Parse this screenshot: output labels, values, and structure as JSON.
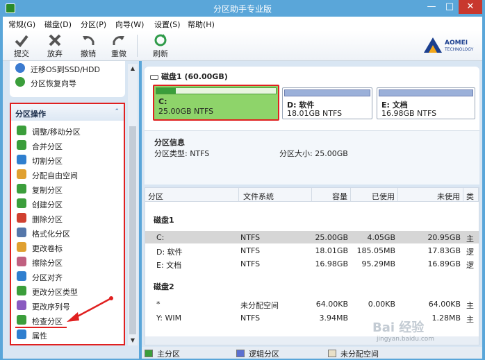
{
  "window": {
    "title": "分区助手专业版"
  },
  "menu": [
    "常规(G)",
    "磁盘(D)",
    "分区(P)",
    "向导(W)",
    "设置(S)",
    "帮助(H)"
  ],
  "toolbar": [
    {
      "label": "提交",
      "icon": "check-icon"
    },
    {
      "label": "放弃",
      "icon": "cross-icon"
    },
    {
      "label": "撤销",
      "icon": "undo-icon"
    },
    {
      "label": "重做",
      "icon": "redo-icon"
    },
    {
      "label": "刷新",
      "icon": "refresh-icon"
    }
  ],
  "brand": {
    "line1": "AOMEI",
    "line2": "TECHNOLOGY"
  },
  "wizard_items": [
    "迁移OS到SSD/HDD",
    "分区恢复向导"
  ],
  "operations": {
    "title": "分区操作",
    "items": [
      "调整/移动分区",
      "合并分区",
      "切割分区",
      "分配自由空间",
      "复制分区",
      "创建分区",
      "删除分区",
      "格式化分区",
      "更改卷标",
      "擦除分区",
      "分区对齐",
      "更改分区类型",
      "更改序列号",
      "检查分区",
      "属性"
    ]
  },
  "disk1": {
    "header": "磁盘1 (60.00GB)",
    "partitions": [
      {
        "name": "C:",
        "detail": "25.00GB NTFS",
        "used_fraction": 0.16
      },
      {
        "name": "D: 软件",
        "detail": "18.01GB NTFS",
        "used_fraction": 0.01
      },
      {
        "name": "E: 文档",
        "detail": "16.98GB NTFS",
        "used_fraction": 0.01
      }
    ]
  },
  "info": {
    "title": "分区信息",
    "type_label": "分区类型: NTFS",
    "size_label": "分区大小: 25.00GB"
  },
  "table": {
    "columns": [
      "分区",
      "文件系统",
      "容量",
      "已使用",
      "未使用",
      "类"
    ],
    "groups": [
      {
        "title": "磁盘1",
        "rows": [
          {
            "partition": "C:",
            "fs": "NTFS",
            "capacity": "25.00GB",
            "used": "4.05GB",
            "free": "20.95GB",
            "type": "主"
          },
          {
            "partition": "D: 软件",
            "fs": "NTFS",
            "capacity": "18.01GB",
            "used": "185.05MB",
            "free": "17.83GB",
            "type": "逻"
          },
          {
            "partition": "E: 文档",
            "fs": "NTFS",
            "capacity": "16.98GB",
            "used": "95.29MB",
            "free": "16.89GB",
            "type": "逻"
          }
        ]
      },
      {
        "title": "磁盘2",
        "rows": [
          {
            "partition": "*",
            "fs": "未分配空间",
            "capacity": "64.00KB",
            "used": "0.00KB",
            "free": "64.00KB",
            "type": "主"
          },
          {
            "partition": "Y: WIM",
            "fs": "NTFS",
            "capacity": "3.94MB",
            "used": "",
            "free": "1.28MB",
            "type": "主"
          }
        ]
      }
    ]
  },
  "legend": [
    "主分区",
    "逻辑分区",
    "未分配空间"
  ],
  "colors": {
    "primary": "#3b9e3b",
    "logical": "#5b6fd0",
    "unallocated": "#e8e0c8",
    "highlight": "#e02020"
  },
  "watermark": {
    "main": "Bai 经验",
    "sub": "jingyan.baidu.com"
  }
}
